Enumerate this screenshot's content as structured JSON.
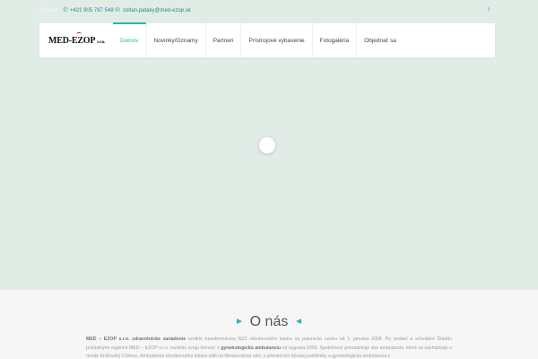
{
  "topbar": {
    "label": "Kontakt",
    "phone": "+421 905 787 548",
    "email": "zoltan.pataky@med-ezop.sk",
    "facebook_glyph": "f"
  },
  "logo": {
    "name": "MED-EZOP",
    "suffix": "s.r.o."
  },
  "nav": {
    "items": [
      {
        "label": "Domov",
        "active": true
      },
      {
        "label": "Novinky/Oznamy"
      },
      {
        "label": "Partneri"
      },
      {
        "label": "Prístrojové vybavenie"
      },
      {
        "label": "Fotogaléria"
      },
      {
        "label": "Objednať sa"
      }
    ]
  },
  "about": {
    "title": "O nás",
    "p1_company": "MED – EZOP s.r.o. zdravotnícke zariadenie",
    "p1_text": " vzniklo transformáciou NZZ všeobecného lekára na právnickú osobu od 1. januára 2008. Po podaní a schválení Štatútu",
    "p2_text": "príslušnými orgánmi MED – EZOP s.r.o. rozšírilo svoju činnosť o ",
    "p2_bold": "gynekologickú ambulanciu",
    "p2_text2": " od augusta 2009. Spoločnosť prevádzkuje dve ambulancie, ktoré sa",
    "p3_text": "nachádzajú v meste Kráľovský Chlmec. Ambulancia všeobecného lekára sídli na Nemocničnej ulici, v priestoroch bývalej polikliniky a gynekologická ambulancia v"
  },
  "colors": {
    "accent": "#29b7b0",
    "hero_bg": "#e2ece7",
    "about_bg": "#f6f6f6"
  },
  "icons": {
    "phone": "phone-icon",
    "email": "envelope-icon",
    "facebook": "facebook-icon"
  }
}
